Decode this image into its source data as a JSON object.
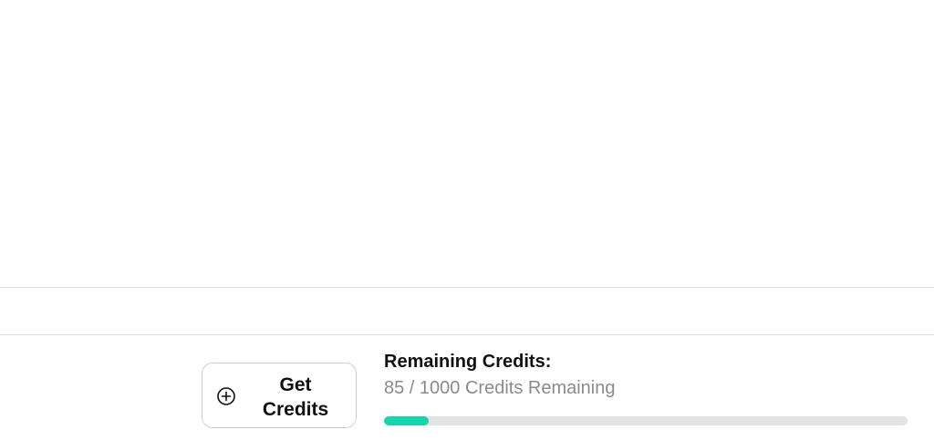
{
  "credits": {
    "button_label": "Get Credits",
    "title": "Remaining Credits:",
    "status_text": "85 / 1000 Credits Remaining",
    "remaining": 85,
    "total": 1000,
    "progress_fraction": 0.085,
    "progress_color": "#17d4ad"
  },
  "icons": {
    "get_credits": "plus-circle-icon"
  }
}
